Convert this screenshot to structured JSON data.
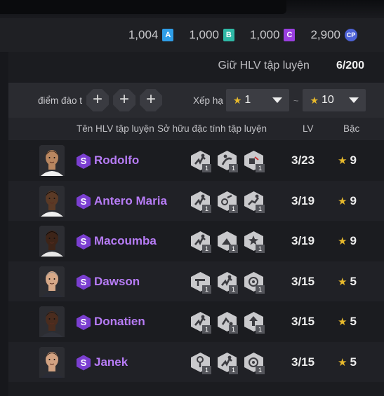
{
  "currency": [
    {
      "value": "1,004",
      "icon": "ticket-a-icon",
      "letter": "A",
      "color": "#2f9ee8"
    },
    {
      "value": "1,000",
      "icon": "ticket-b-icon",
      "letter": "B",
      "color": "#2fb9a6"
    },
    {
      "value": "1,000",
      "icon": "ticket-c-icon",
      "letter": "C",
      "color": "#9a3fe0"
    },
    {
      "value": "2,900",
      "icon": "cp-coin-icon",
      "letter": "CP",
      "color": "#4d62d6"
    }
  ],
  "keep": {
    "label": "Giữ HLV tập luyện",
    "value": "6/200"
  },
  "filter": {
    "points_label": "điểm đào t",
    "plus": [
      "+",
      "+",
      "+"
    ],
    "rank_label": "Xếp hạ",
    "min_value": "1",
    "max_value": "10",
    "separator": "~"
  },
  "columns": {
    "name": "Tên HLV tập luyện",
    "traits": "Sở hữu đặc tính tập luyện",
    "lv": "LV",
    "rank": "Bậc"
  },
  "badge_letter": "S",
  "star_glyph": "★",
  "rows": [
    {
      "name": "Rodolfo",
      "lv": "3/23",
      "rank": "9",
      "skin": "#b88660",
      "hair": "#2b1c12",
      "shirt": "#f0f0f0",
      "traits": [
        {
          "icon": "jump-icon",
          "level": "1"
        },
        {
          "icon": "twist-icon",
          "level": "1"
        },
        {
          "icon": "shield-boot-icon",
          "level": "1"
        }
      ]
    },
    {
      "name": "Antero Maria",
      "lv": "3/19",
      "rank": "9",
      "skin": "#5b3a26",
      "hair": "#140d08",
      "shirt": "#f0f0f0",
      "traits": [
        {
          "icon": "jump-icon",
          "level": "1"
        },
        {
          "icon": "ball-kick-icon",
          "level": "1"
        },
        {
          "icon": "sprint-icon",
          "level": "1"
        }
      ]
    },
    {
      "name": "Macoumba",
      "lv": "3/19",
      "rank": "9",
      "skin": "#3d2418",
      "hair": "#0e0805",
      "shirt": "#e8e8e8",
      "traits": [
        {
          "icon": "jump-icon",
          "level": "1"
        },
        {
          "icon": "slide-icon",
          "level": "1"
        },
        {
          "icon": "star-player-icon",
          "level": "1"
        }
      ]
    },
    {
      "name": "Dawson",
      "lv": "3/15",
      "rank": "5",
      "skin": "#d6a888",
      "hair": "#8d8d8d",
      "shirt": "#2a2c36",
      "traits": [
        {
          "icon": "tackle-icon",
          "level": "1"
        },
        {
          "icon": "jump-icon",
          "level": "1"
        },
        {
          "icon": "ball-control-icon",
          "level": "1"
        }
      ]
    },
    {
      "name": "Donatien",
      "lv": "3/15",
      "rank": "5",
      "skin": "#4a2c1e",
      "hair": "#1a1a1a",
      "shirt": "#30323a",
      "traits": [
        {
          "icon": "jump-icon",
          "level": "1"
        },
        {
          "icon": "dribble-icon",
          "level": "1"
        },
        {
          "icon": "arrow-up-icon",
          "level": "1"
        }
      ]
    },
    {
      "name": "Janek",
      "lv": "3/15",
      "rank": "5",
      "skin": "#d2a282",
      "hair": "#2a1d15",
      "shirt": "#2a2c36",
      "traits": [
        {
          "icon": "header-icon",
          "level": "1"
        },
        {
          "icon": "jump-icon",
          "level": "1"
        },
        {
          "icon": "ball-control-icon",
          "level": "1"
        }
      ]
    }
  ]
}
